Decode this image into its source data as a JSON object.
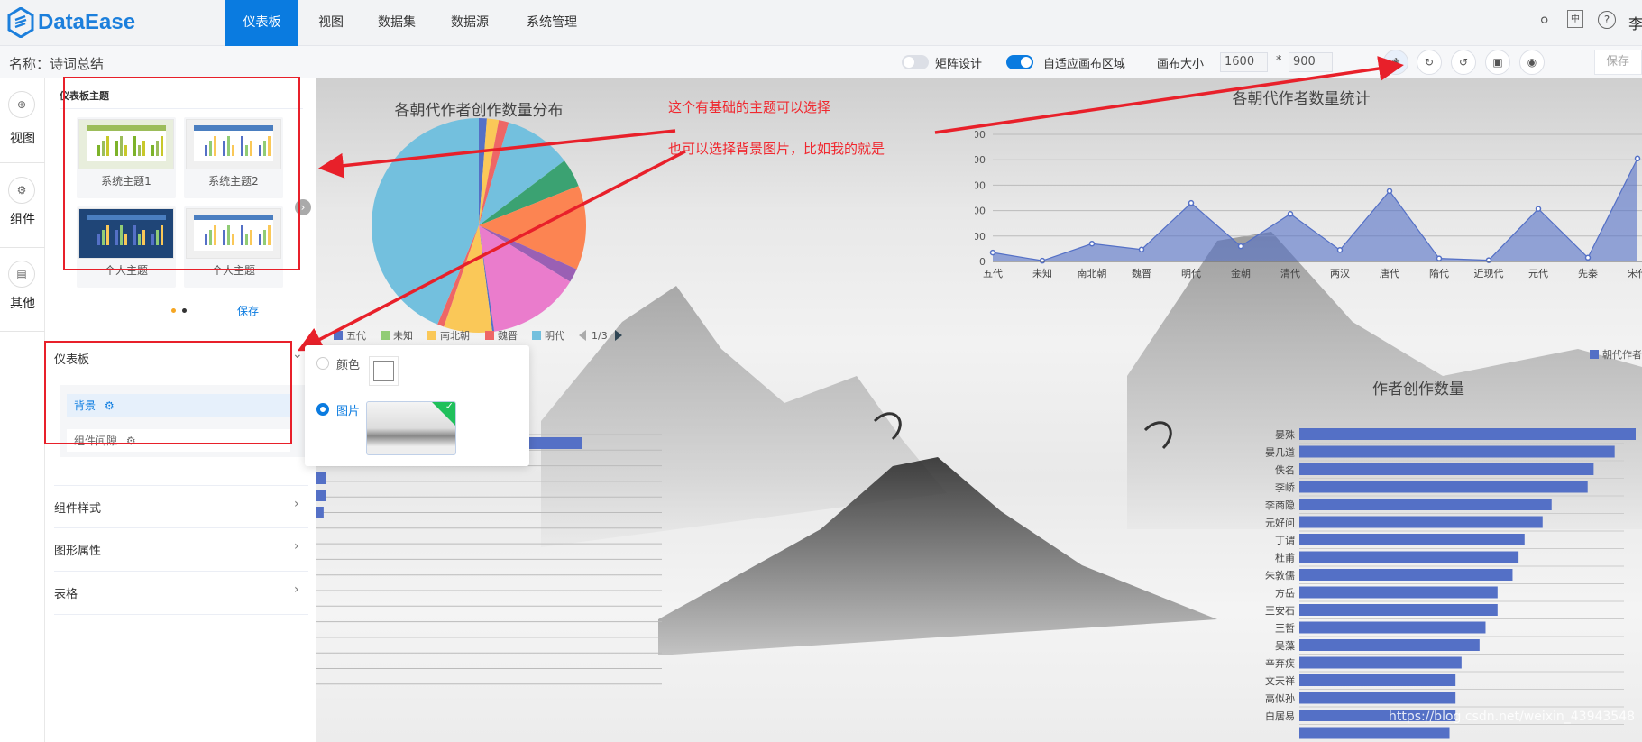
{
  "app": {
    "logo_text": "DataEase",
    "brand_color": "#0a7be0"
  },
  "nav": {
    "items": [
      {
        "label": "仪表板",
        "active": true
      },
      {
        "label": "视图"
      },
      {
        "label": "数据集"
      },
      {
        "label": "数据源"
      },
      {
        "label": "系统管理"
      }
    ]
  },
  "header_right": {
    "icons": [
      "bell-icon",
      "language-icon",
      "help-icon"
    ],
    "user": "李"
  },
  "subbar": {
    "name_label": "名称：诗词总结",
    "matrix_toggle": {
      "label": "矩阵设计",
      "on": false
    },
    "adaptive_toggle": {
      "label": "自适应画布区域",
      "on": true
    },
    "canvas_size_label": "画布大小",
    "canvas_width": "1600",
    "times": "*",
    "canvas_height": "900",
    "tool_icons": [
      "theme-icon",
      "refresh-icon",
      "undo-icon",
      "export-icon",
      "preview-icon"
    ],
    "save_label": "保存"
  },
  "strip": {
    "items": [
      {
        "label": "视图",
        "icon": "plus-circle-icon"
      },
      {
        "label": "组件",
        "icon": "gear-icon"
      },
      {
        "label": "其他",
        "icon": "other-icon"
      }
    ]
  },
  "panel": {
    "theme_title": "仪表板主题",
    "themes": [
      {
        "label": "系统主题1",
        "bar_color": "#9cbd5a",
        "bg": "#e8eedc"
      },
      {
        "label": "系统主题2",
        "bar_color": "#4a7ec0",
        "bg": "#f0f0f0"
      },
      {
        "label": "个人主题",
        "bar_color": "#4a7ec0",
        "bg": "#1f4577"
      },
      {
        "label": "个人主题",
        "bar_color": "#4a7ec0",
        "bg": "#f0f0f0"
      }
    ],
    "theme_page": 1,
    "theme_pages": 2,
    "theme_save": "保存",
    "dashboard_section": "仪表板",
    "sub_items": [
      {
        "label": "背景",
        "active": true
      },
      {
        "label": "组件间隙",
        "active": false
      }
    ],
    "sections": [
      "组件样式",
      "图形属性",
      "表格"
    ]
  },
  "popup": {
    "color_option": "颜色",
    "image_option": "图片",
    "selected": "图片"
  },
  "annotations": [
    "这个有基础的主题可以选择",
    "也可以选择背景图片，比如我的就是"
  ],
  "watermark": "https://blog.csdn.net/weixin_43943548",
  "chart_data": [
    {
      "type": "pie",
      "title": "各朝代作者创作数量分布",
      "legend": [
        {
          "name": "五代",
          "color": "#5470c6"
        },
        {
          "name": "未知",
          "color": "#91cc75"
        },
        {
          "name": "南北朝",
          "color": "#fac858"
        },
        {
          "name": "魏晋",
          "color": "#ee6666"
        },
        {
          "name": "明代",
          "color": "#73c0de"
        }
      ],
      "legend_page": "1/3",
      "slices": [
        {
          "value": 1.2,
          "color": "#5470c6"
        },
        {
          "value": 1.8,
          "color": "#fac858"
        },
        {
          "value": 1.5,
          "color": "#ee6666"
        },
        {
          "value": 10.2,
          "color": "#73c0de"
        },
        {
          "value": 4.3,
          "color": "#3ba272"
        },
        {
          "value": 12.7,
          "color": "#fc8452"
        },
        {
          "value": 2.1,
          "color": "#9a60b4"
        },
        {
          "value": 13.9,
          "color": "#ea7ccc"
        },
        {
          "value": 0.3,
          "color": "#5470c6"
        },
        {
          "value": 7.3,
          "color": "#fac858"
        },
        {
          "value": 1.0,
          "color": "#ee6666"
        },
        {
          "value": 43.7,
          "color": "#73c0de"
        }
      ]
    },
    {
      "type": "area",
      "title": "各朝代作者数量统计",
      "categories": [
        "五代",
        "未知",
        "南北朝",
        "魏晋",
        "明代",
        "金朝",
        "清代",
        "两汉",
        "唐代",
        "隋代",
        "近现代",
        "元代",
        "先秦",
        "宋代"
      ],
      "series": [
        {
          "name": "朝代作者",
          "values": [
            35,
            3,
            70,
            47,
            230,
            60,
            187,
            45,
            277,
            12,
            5,
            207,
            15,
            405
          ],
          "color": "#5470c6"
        }
      ],
      "yticks": [
        0,
        100,
        200,
        300,
        400,
        500
      ],
      "ylim": [
        0,
        500
      ],
      "grid": true,
      "legend": "bottom"
    },
    {
      "type": "bar",
      "orientation": "horizontal",
      "title": "作者创作数量",
      "categories": [
        "晏殊",
        "晏几道",
        "佚名",
        "李峤",
        "李商隐",
        "元好问",
        "丁谓",
        "杜甫",
        "朱敦儒",
        "方岳",
        "王安石",
        "王哲",
        "吴藻",
        "辛弃疾",
        "文天祥",
        "高似孙",
        "白居易",
        ""
      ],
      "values": [
        112,
        105,
        98,
        96,
        84,
        81,
        75,
        73,
        71,
        66,
        66,
        62,
        60,
        54,
        52,
        52,
        52,
        50
      ],
      "color": "#5470c6",
      "grid": true
    },
    {
      "type": "bar",
      "orientation": "horizontal",
      "values": [
        100,
        4,
        4,
        3
      ],
      "color": "#5470c6",
      "grid": true
    }
  ]
}
